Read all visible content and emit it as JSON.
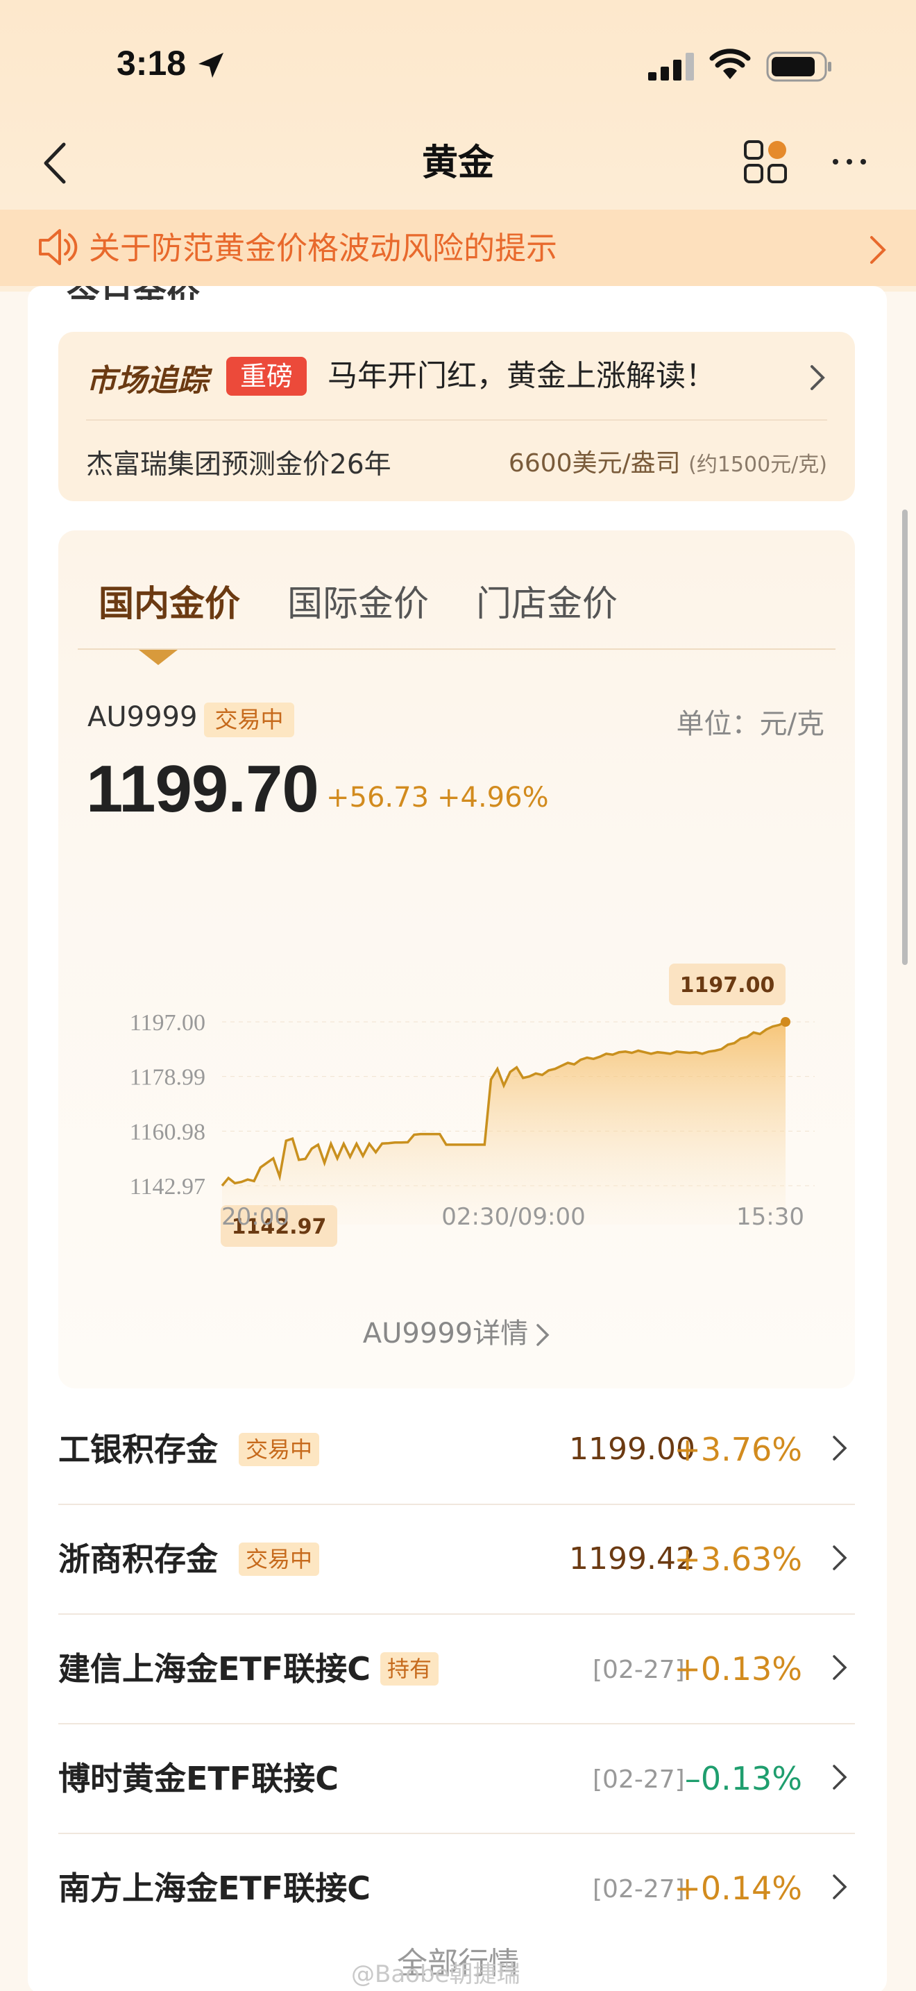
{
  "status_bar": {
    "time": "3:18"
  },
  "nav": {
    "title": "黄金"
  },
  "notice": {
    "text": "关于防范黄金价格波动风险的提示"
  },
  "section_peek": "今日金价",
  "tracker": {
    "brand": "市场追踪",
    "tag": "重磅",
    "headline": "马年开门红，黄金上涨解读！",
    "subline": "杰富瑞集团预测金价26年",
    "value": "6600美元/盎司",
    "value_note": "(约1500元/克)"
  },
  "tabs": [
    "国内金价",
    "国际金价",
    "门店金价"
  ],
  "quote": {
    "code": "AU9999",
    "status": "交易中",
    "unit": "单位：元/克",
    "price": "1199.70",
    "change": "+56.73",
    "change_pct": "+4.96%"
  },
  "chart_data": {
    "type": "area",
    "y_ticks": [
      "1197.00",
      "1178.99",
      "1160.98",
      "1142.97"
    ],
    "x_ticks": [
      "20:00",
      "02:30/09:00",
      "15:30"
    ],
    "ylim": [
      1142.97,
      1197.0
    ],
    "max_label": "1197.00",
    "min_label": "1142.97",
    "values": [
      1142.97,
      1145.5,
      1143.8,
      1144.2,
      1145.0,
      1144.5,
      1149.0,
      1150.5,
      1152.0,
      1146.0,
      1157.8,
      1158.5,
      1151.5,
      1151.8,
      1155.2,
      1156.5,
      1150.5,
      1156.8,
      1152.0,
      1156.8,
      1152.5,
      1156.8,
      1152.8,
      1156.8,
      1154.0,
      1156.9,
      1157.0,
      1157.2,
      1157.2,
      1157.3,
      1159.8,
      1160.0,
      1160.0,
      1160.0,
      1160.0,
      1156.5,
      1156.5,
      1156.5,
      1156.5,
      1156.5,
      1156.5,
      1156.5,
      1178.0,
      1181.5,
      1176.0,
      1180.5,
      1182.0,
      1178.5,
      1179.0,
      1180.0,
      1179.5,
      1181.0,
      1181.5,
      1182.5,
      1183.5,
      1183.0,
      1184.5,
      1185.2,
      1184.8,
      1185.5,
      1186.5,
      1186.2,
      1187.0,
      1187.2,
      1186.8,
      1187.5,
      1187.0,
      1186.5,
      1187.0,
      1186.8,
      1186.5,
      1187.2,
      1187.0,
      1186.8,
      1187.0,
      1186.5,
      1187.2,
      1187.5,
      1188.0,
      1189.5,
      1190.0,
      1191.5,
      1192.0,
      1193.5,
      1193.0,
      1194.5,
      1195.5,
      1196.0,
      1197.0
    ],
    "detail_link": "AU9999详情"
  },
  "list": [
    {
      "name": "工银积存金",
      "tag": "交易中",
      "price": "1199.00",
      "pct": "+3.76%",
      "dir": "up"
    },
    {
      "name": "浙商积存金",
      "tag": "交易中",
      "price": "1199.42",
      "pct": "+3.63%",
      "dir": "up"
    },
    {
      "name": "建信上海金ETF联接C",
      "tag": "持有",
      "date": "[02-27]",
      "pct": "+0.13%",
      "dir": "up"
    },
    {
      "name": "博时黄金ETF联接C",
      "date": "[02-27]",
      "pct": "–0.13%",
      "dir": "down"
    },
    {
      "name": "南方上海金ETF联接C",
      "date": "[02-27]",
      "pct": "+0.14%",
      "dir": "up"
    }
  ],
  "all_link": "全部行情",
  "watermark": "@Baobe朝捷瑞",
  "colors": {
    "accent": "#d28b1e",
    "brown": "#6b3a12",
    "notice": "#e8692c",
    "down": "#1f9e6e"
  }
}
